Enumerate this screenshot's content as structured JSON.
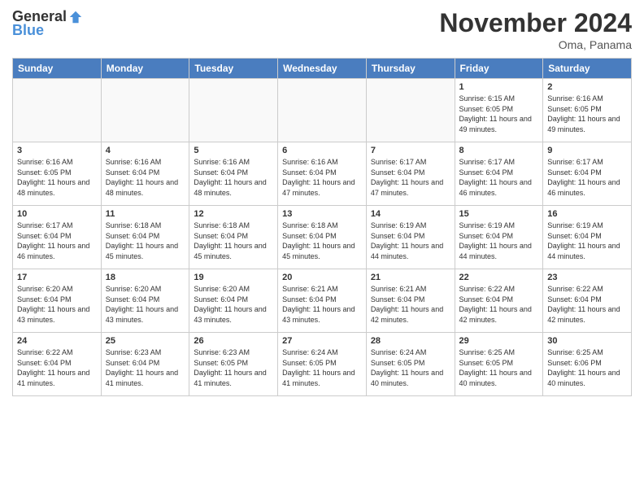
{
  "header": {
    "logo_general": "General",
    "logo_blue": "Blue",
    "month_title": "November 2024",
    "location": "Oma, Panama"
  },
  "days_of_week": [
    "Sunday",
    "Monday",
    "Tuesday",
    "Wednesday",
    "Thursday",
    "Friday",
    "Saturday"
  ],
  "weeks": [
    [
      {
        "day": "",
        "info": ""
      },
      {
        "day": "",
        "info": ""
      },
      {
        "day": "",
        "info": ""
      },
      {
        "day": "",
        "info": ""
      },
      {
        "day": "",
        "info": ""
      },
      {
        "day": "1",
        "info": "Sunrise: 6:15 AM\nSunset: 6:05 PM\nDaylight: 11 hours and 49 minutes."
      },
      {
        "day": "2",
        "info": "Sunrise: 6:16 AM\nSunset: 6:05 PM\nDaylight: 11 hours and 49 minutes."
      }
    ],
    [
      {
        "day": "3",
        "info": "Sunrise: 6:16 AM\nSunset: 6:05 PM\nDaylight: 11 hours and 48 minutes."
      },
      {
        "day": "4",
        "info": "Sunrise: 6:16 AM\nSunset: 6:04 PM\nDaylight: 11 hours and 48 minutes."
      },
      {
        "day": "5",
        "info": "Sunrise: 6:16 AM\nSunset: 6:04 PM\nDaylight: 11 hours and 48 minutes."
      },
      {
        "day": "6",
        "info": "Sunrise: 6:16 AM\nSunset: 6:04 PM\nDaylight: 11 hours and 47 minutes."
      },
      {
        "day": "7",
        "info": "Sunrise: 6:17 AM\nSunset: 6:04 PM\nDaylight: 11 hours and 47 minutes."
      },
      {
        "day": "8",
        "info": "Sunrise: 6:17 AM\nSunset: 6:04 PM\nDaylight: 11 hours and 46 minutes."
      },
      {
        "day": "9",
        "info": "Sunrise: 6:17 AM\nSunset: 6:04 PM\nDaylight: 11 hours and 46 minutes."
      }
    ],
    [
      {
        "day": "10",
        "info": "Sunrise: 6:17 AM\nSunset: 6:04 PM\nDaylight: 11 hours and 46 minutes."
      },
      {
        "day": "11",
        "info": "Sunrise: 6:18 AM\nSunset: 6:04 PM\nDaylight: 11 hours and 45 minutes."
      },
      {
        "day": "12",
        "info": "Sunrise: 6:18 AM\nSunset: 6:04 PM\nDaylight: 11 hours and 45 minutes."
      },
      {
        "day": "13",
        "info": "Sunrise: 6:18 AM\nSunset: 6:04 PM\nDaylight: 11 hours and 45 minutes."
      },
      {
        "day": "14",
        "info": "Sunrise: 6:19 AM\nSunset: 6:04 PM\nDaylight: 11 hours and 44 minutes."
      },
      {
        "day": "15",
        "info": "Sunrise: 6:19 AM\nSunset: 6:04 PM\nDaylight: 11 hours and 44 minutes."
      },
      {
        "day": "16",
        "info": "Sunrise: 6:19 AM\nSunset: 6:04 PM\nDaylight: 11 hours and 44 minutes."
      }
    ],
    [
      {
        "day": "17",
        "info": "Sunrise: 6:20 AM\nSunset: 6:04 PM\nDaylight: 11 hours and 43 minutes."
      },
      {
        "day": "18",
        "info": "Sunrise: 6:20 AM\nSunset: 6:04 PM\nDaylight: 11 hours and 43 minutes."
      },
      {
        "day": "19",
        "info": "Sunrise: 6:20 AM\nSunset: 6:04 PM\nDaylight: 11 hours and 43 minutes."
      },
      {
        "day": "20",
        "info": "Sunrise: 6:21 AM\nSunset: 6:04 PM\nDaylight: 11 hours and 43 minutes."
      },
      {
        "day": "21",
        "info": "Sunrise: 6:21 AM\nSunset: 6:04 PM\nDaylight: 11 hours and 42 minutes."
      },
      {
        "day": "22",
        "info": "Sunrise: 6:22 AM\nSunset: 6:04 PM\nDaylight: 11 hours and 42 minutes."
      },
      {
        "day": "23",
        "info": "Sunrise: 6:22 AM\nSunset: 6:04 PM\nDaylight: 11 hours and 42 minutes."
      }
    ],
    [
      {
        "day": "24",
        "info": "Sunrise: 6:22 AM\nSunset: 6:04 PM\nDaylight: 11 hours and 41 minutes."
      },
      {
        "day": "25",
        "info": "Sunrise: 6:23 AM\nSunset: 6:04 PM\nDaylight: 11 hours and 41 minutes."
      },
      {
        "day": "26",
        "info": "Sunrise: 6:23 AM\nSunset: 6:05 PM\nDaylight: 11 hours and 41 minutes."
      },
      {
        "day": "27",
        "info": "Sunrise: 6:24 AM\nSunset: 6:05 PM\nDaylight: 11 hours and 41 minutes."
      },
      {
        "day": "28",
        "info": "Sunrise: 6:24 AM\nSunset: 6:05 PM\nDaylight: 11 hours and 40 minutes."
      },
      {
        "day": "29",
        "info": "Sunrise: 6:25 AM\nSunset: 6:05 PM\nDaylight: 11 hours and 40 minutes."
      },
      {
        "day": "30",
        "info": "Sunrise: 6:25 AM\nSunset: 6:06 PM\nDaylight: 11 hours and 40 minutes."
      }
    ]
  ]
}
